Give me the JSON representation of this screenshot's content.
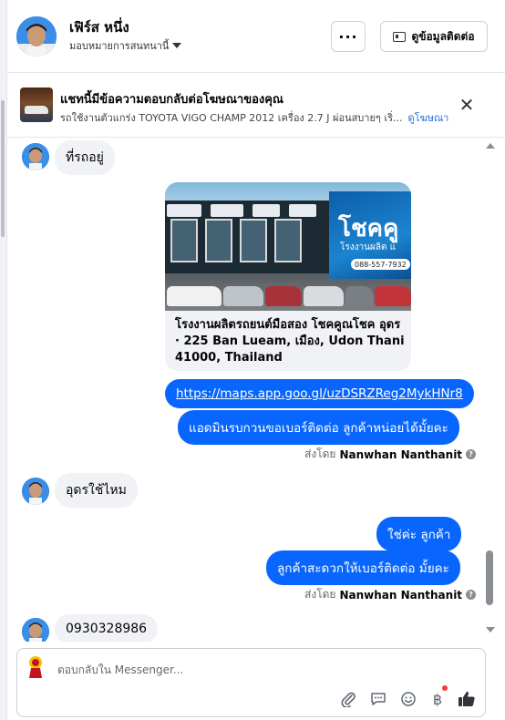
{
  "header": {
    "user_name": "เฟิร์ส หนึ่ง",
    "assign_label": "มอบหมายการสนทนานี้",
    "more_label": "···",
    "contact_button_label": "ดูข้อมูลติดต่อ"
  },
  "ad_banner": {
    "title": "แชทนี้มีข้อความตอบกลับต่อโฆษณาของคุณ",
    "description": "รถใช้งานตัวแกร่ง TOYOTA VIGO CHAMP 2012 เครื่อง 2.7 J ผ่อนสบายๆ เริ่...",
    "view_ad_label": "ดูโฆษณา",
    "close_label": "✕"
  },
  "messages": [
    {
      "direction": "in",
      "text": "ที่รถอยู่"
    },
    {
      "direction": "out",
      "type": "location",
      "caption": "โรงงานผลิตรถยนต์มือสอง โชคคูณโชค อุดร · 225 Ban Lueam, เมือง, Udon Thani 41000, Thailand",
      "image_text": {
        "sign_main": "โชคคู",
        "sign_sub": "โรงงานผลิต แ",
        "phone": "088-557-7932"
      }
    },
    {
      "direction": "out",
      "type": "link",
      "text": "https://maps.app.goo.gl/uzDSRZReg2MykHNr8"
    },
    {
      "direction": "out",
      "text": "แอดมินรบกวนขอเบอร์ติดต่อ ลูกค้าหน่อยได้มั้ยคะ"
    },
    {
      "direction": "in",
      "text": "อุดรใช้ไหม"
    },
    {
      "direction": "out",
      "text": "ใช่ค่ะ ลูกค้า"
    },
    {
      "direction": "out",
      "text": "ลูกค้าสะดวกให้เบอร์ติดต่อ มั้ยคะ"
    },
    {
      "direction": "in",
      "text": "0930328986"
    }
  ],
  "sent_by": {
    "prefix": "ส่งโดย",
    "name": "Nanwhan Nanthanit"
  },
  "composer": {
    "placeholder": "ตอบกลับใน Messenger..."
  },
  "colors": {
    "outgoing_bubble": "#0866ff",
    "incoming_bubble": "#f0f2f5",
    "link": "#216fdb"
  }
}
